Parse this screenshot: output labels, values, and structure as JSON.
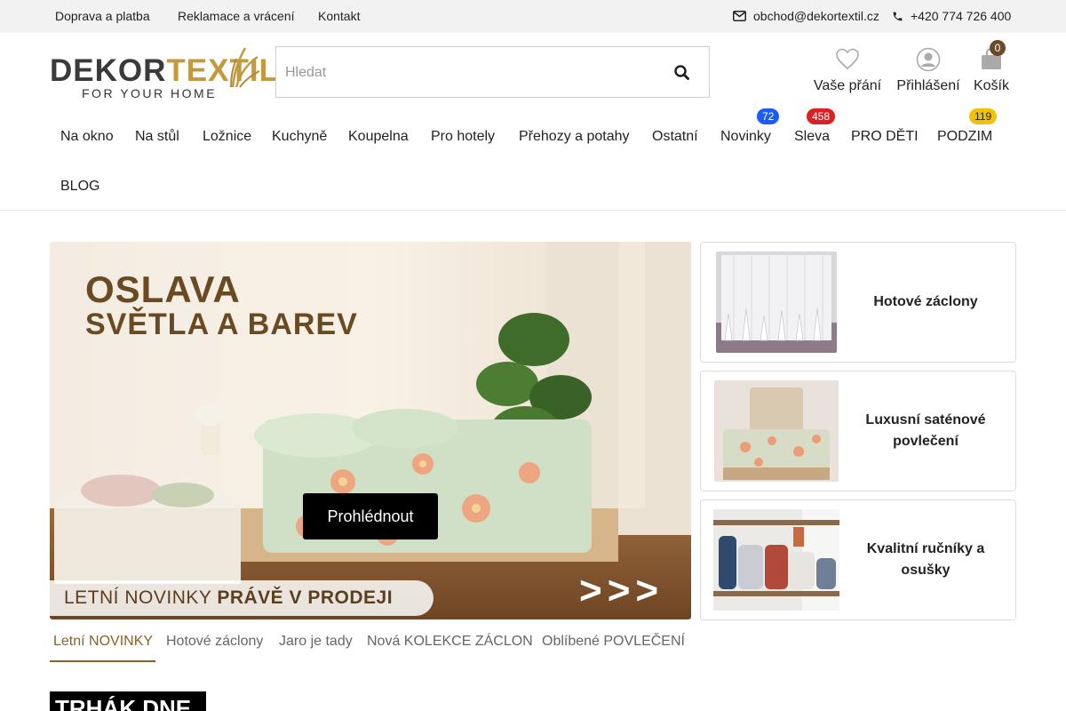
{
  "topbar": {
    "links": [
      "Doprava a platba",
      "Reklamace a vrácení",
      "Kontakt"
    ],
    "email": "obchod@dekortextil.cz",
    "phone": "+420 774 726 400"
  },
  "logo": {
    "brand_part1": "DEKOR",
    "brand_part2": "TEXTIL",
    "tagline": "FOR YOUR HOME"
  },
  "search": {
    "placeholder": "Hledat"
  },
  "header_actions": {
    "wishlist": "Vaše přání",
    "login": "Přihlášení",
    "cart": "Košík",
    "cart_count": "0"
  },
  "nav": {
    "items": [
      "Na okno",
      "Na stůl",
      "Ložnice",
      "Kuchyně",
      "Koupelna",
      "Pro hotely",
      "Přehozy a potahy",
      "Ostatní",
      "Novinky",
      "Sleva",
      "PRO DĚTI",
      "PODZIM",
      "BLOG"
    ],
    "badges": {
      "novinky": "72",
      "sleva": "458",
      "podzim": "119"
    },
    "badge_colors": {
      "novinky": "#1d5cf2",
      "sleva": "#e02020",
      "podzim": "#f2c200"
    }
  },
  "hero": {
    "title_line1": "OSLAVA",
    "title_line2": "SVĚTLA A BAREV",
    "cta": "Prohlédnout",
    "strip_normal": "LETNÍ NOVINKY ",
    "strip_bold": "PRÁVĚ V PRODEJI",
    "arrows": ">>>"
  },
  "side_cards": [
    {
      "title": "Hotové záclony"
    },
    {
      "title": "Luxusní saténové povlečení"
    },
    {
      "title": "Kvalitní ručníky a osušky"
    }
  ],
  "tabs": [
    "Letní NOVINKY",
    "Hotové záclony",
    "Jaro je tady",
    "Nová KOLEKCE ZÁCLON",
    "Oblíbené POVLEČENÍ"
  ],
  "section_heading": "TRHÁK DNE",
  "colors": {
    "accent_gold": "#c29a3d",
    "topbar_bg": "#f2f2f2",
    "active_tab": "#8a6420"
  }
}
